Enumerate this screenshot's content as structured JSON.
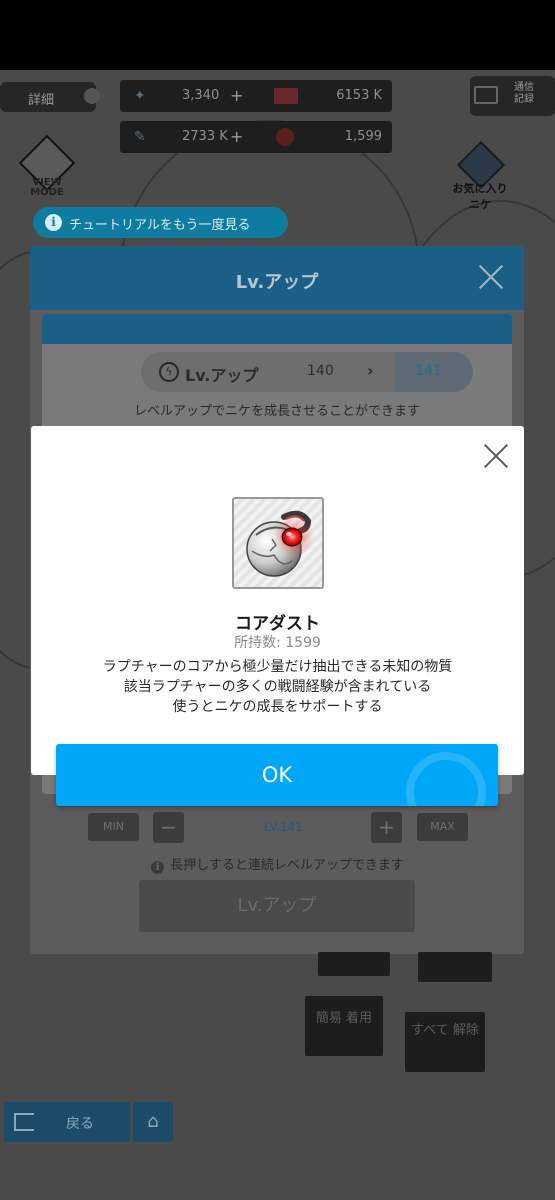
{
  "header": {
    "detail_label": "詳細",
    "resources": [
      {
        "icon": "gem-icon",
        "value": "3,340",
        "has_plus": true
      },
      {
        "icon": "credit-icon",
        "value": "6153 K",
        "has_plus": false
      },
      {
        "icon": "battle-data-icon",
        "value": "2733 K",
        "has_plus": true
      },
      {
        "icon": "core-dust-icon",
        "value": "1,599",
        "has_plus": false
      }
    ],
    "mail_label": "通信 記録"
  },
  "view_mode_label": "VIEW MODE",
  "favorite_label": "お気に入りニケ",
  "tutorial_label": "チュートリアルをもう一度見る",
  "levelup_panel": {
    "title": "Lv.アップ",
    "row_label": "Lv.アップ",
    "current_level": "140",
    "next_level": "141",
    "description": "レベルアップでニケを成長させることができます",
    "min_label": "MIN",
    "max_label": "MAX",
    "level_indicator": "LV.141",
    "hint": "長押しすると連続レベルアップできます",
    "button_label": "Lv.アップ"
  },
  "equipment": {
    "simple_equip": "簡易 着用",
    "unequip_all": "すべて 解除"
  },
  "footer": {
    "back_label": "戻る"
  },
  "modal": {
    "item_name": "コアダスト",
    "count_label": "所持数: 1599",
    "description_lines": [
      "ラプチャーのコアから極少量だけ抽出できる未知の物質",
      "該当ラプチャーの多くの戦闘経験が含まれている",
      "使うとニケの成長をサポートする"
    ],
    "ok_label": "OK"
  },
  "colors": {
    "ok_button": "#00a6f7",
    "modal_bg": "#ffffff",
    "panel_header": "#1c5f86",
    "tutorial_pill": "#0f7ba0"
  }
}
